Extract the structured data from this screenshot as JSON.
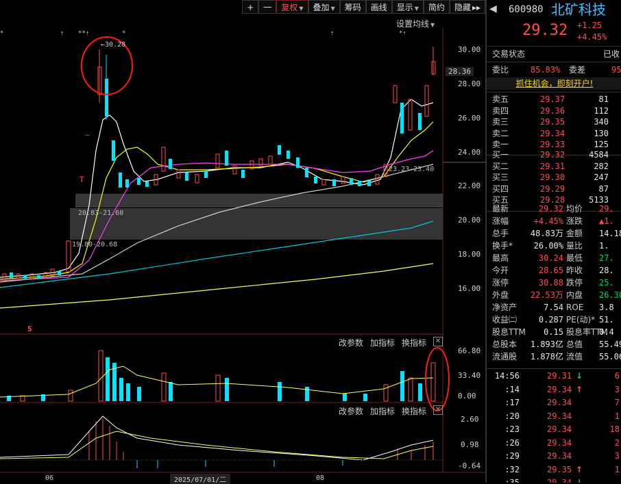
{
  "toolbar": {
    "plus": "+",
    "minus": "一",
    "fuquan": "复权",
    "diejia": "叠加",
    "chouma": "筹码",
    "huaxian": "画线",
    "xianshi": "显示",
    "jianyue": "简约",
    "yincang": "隐藏",
    "more": "▸▸"
  },
  "set_ma": "设置均线",
  "annotations": {
    "high_note": "←30.28",
    "zone1": "20.83-21.60",
    "zone2": "19.80-20.68",
    "zone3": "23.23-23.40",
    "s_mark": "S",
    "t_mark": "T",
    "dash_mark": "—"
  },
  "price_axis": [
    "30.00",
    "28.00",
    "26.00",
    "24.00",
    "22.00",
    "20.00",
    "18.00",
    "16.00"
  ],
  "current_price_tag": "28.36",
  "vol_axis": [
    "66.80",
    "33.40",
    "0.00"
  ],
  "macd_axis": [
    "2.60",
    "0.98",
    "-0.64"
  ],
  "sub_menu": {
    "gaicanshu": "改参数",
    "jiazhibiao": "加指标",
    "huanzhibiao": "换指标",
    "close": "✕"
  },
  "date_axis": {
    "d1": "06",
    "d2": "2025/07/01/二",
    "d3": "08"
  },
  "stock": {
    "code": "600980",
    "name": "北矿科技",
    "price": "29.32",
    "change": "+1.25",
    "pct": "+4.45%"
  },
  "status": {
    "label": "交易状态",
    "value": "已收"
  },
  "weibi": {
    "label1": "委比",
    "val1": "85.83%",
    "label2": "委差",
    "val2": "95"
  },
  "promo": "抓住机会，即刻开户!",
  "sells": [
    {
      "l": "卖五",
      "p": "29.37",
      "v": "81"
    },
    {
      "l": "卖四",
      "p": "29.36",
      "v": "112"
    },
    {
      "l": "卖三",
      "p": "29.35",
      "v": "340"
    },
    {
      "l": "卖二",
      "p": "29.34",
      "v": "130"
    },
    {
      "l": "卖一",
      "p": "29.33",
      "v": "125"
    }
  ],
  "buys": [
    {
      "l": "买一",
      "p": "29.32",
      "v": "4584"
    },
    {
      "l": "买二",
      "p": "29.31",
      "v": "282"
    },
    {
      "l": "买三",
      "p": "29.30",
      "v": "247"
    },
    {
      "l": "买四",
      "p": "29.29",
      "v": "87"
    },
    {
      "l": "买五",
      "p": "29.28",
      "v": "5133"
    }
  ],
  "stats": [
    {
      "l1": "最新",
      "v1": "29.32",
      "c1": "red",
      "l2": "均价",
      "v2": "29.",
      "c2": "red"
    },
    {
      "l1": "涨幅",
      "v1": "+4.45%",
      "c1": "red",
      "l2": "涨跌",
      "v2": "▲1.",
      "c2": "red"
    },
    {
      "l1": "总手",
      "v1": "48.83万",
      "c1": "white",
      "l2": "金额",
      "v2": "14.18",
      "c2": "white"
    },
    {
      "l1": "换手*",
      "v1": "26.00%",
      "c1": "white",
      "l2": "量比",
      "v2": "1.",
      "c2": "white"
    },
    {
      "l1": "最高",
      "v1": "30.24",
      "c1": "red",
      "l2": "最低",
      "v2": "27.",
      "c2": "green"
    },
    {
      "l1": "今开",
      "v1": "28.65",
      "c1": "red",
      "l2": "昨收",
      "v2": "28.",
      "c2": "white"
    },
    {
      "l1": "涨停",
      "v1": "30.88",
      "c1": "red",
      "l2": "跌停",
      "v2": "25.",
      "c2": "green"
    },
    {
      "l1": "外盘",
      "v1": "22.53万",
      "c1": "red",
      "l2": "内盘",
      "v2": "26.30",
      "c2": "green"
    },
    {
      "l1": "净资产",
      "v1": "7.54",
      "c1": "white",
      "l2": "ROE",
      "v2": "3.8",
      "c2": "white"
    },
    {
      "l1": "收益㈡",
      "v1": "0.287",
      "c1": "white",
      "l2": "PE(动)*",
      "v2": "51.",
      "c2": "white"
    },
    {
      "l1": "股息TTM",
      "v1": "0.15",
      "c1": "white",
      "l2": "股息率TTM",
      "v2": "0.4",
      "c2": "white"
    },
    {
      "l1": "总股本",
      "v1": "1.893亿",
      "c1": "white",
      "l2": "总值",
      "v2": "55.49",
      "c2": "white"
    },
    {
      "l1": "流通股",
      "v1": "1.878亿",
      "c1": "white",
      "l2": "流值",
      "v2": "55.06",
      "c2": "white"
    }
  ],
  "ticks": [
    {
      "t": "14:56",
      "p": "29.31",
      "a": "↓",
      "ac": "green",
      "v": "6"
    },
    {
      "t": ":14",
      "p": "29.34",
      "a": "↑",
      "ac": "red",
      "v": "3"
    },
    {
      "t": ":17",
      "p": "29.34",
      "a": "",
      "ac": "red",
      "v": "7"
    },
    {
      "t": ":20",
      "p": "29.34",
      "a": "",
      "ac": "red",
      "v": "1"
    },
    {
      "t": ":23",
      "p": "29.34",
      "a": "",
      "ac": "red",
      "v": "18"
    },
    {
      "t": ":26",
      "p": "29.34",
      "a": "",
      "ac": "red",
      "v": "2"
    },
    {
      "t": ":29",
      "p": "29.34",
      "a": "",
      "ac": "red",
      "v": "3"
    },
    {
      "t": ":32",
      "p": "29.35",
      "a": "↑",
      "ac": "red",
      "v": "1"
    },
    {
      "t": ":35",
      "p": "29.34",
      "a": "↓",
      "ac": "green",
      "v": ""
    }
  ]
}
